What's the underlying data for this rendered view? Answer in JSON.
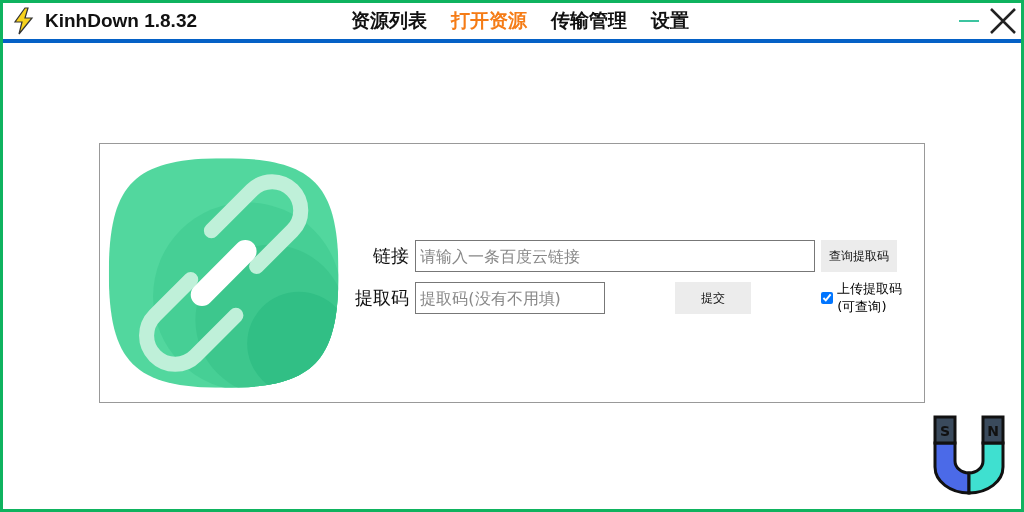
{
  "window": {
    "title": "KinhDown 1.8.32"
  },
  "tabs": [
    {
      "label": "资源列表",
      "selected": false
    },
    {
      "label": "打开资源",
      "selected": true
    },
    {
      "label": "传输管理",
      "selected": false
    },
    {
      "label": "设置",
      "selected": false
    }
  ],
  "form": {
    "link_label": "链接",
    "link_placeholder": "请输入一条百度云链接",
    "query_button": "查询提取码",
    "code_label": "提取码",
    "code_placeholder": "提取码(没有不用填)",
    "submit_button": "提交",
    "upload_checkbox": {
      "label": "上传提取码(可查询)",
      "checked": true
    }
  },
  "magnet": {
    "left_pole": "S",
    "right_pole": "N"
  }
}
